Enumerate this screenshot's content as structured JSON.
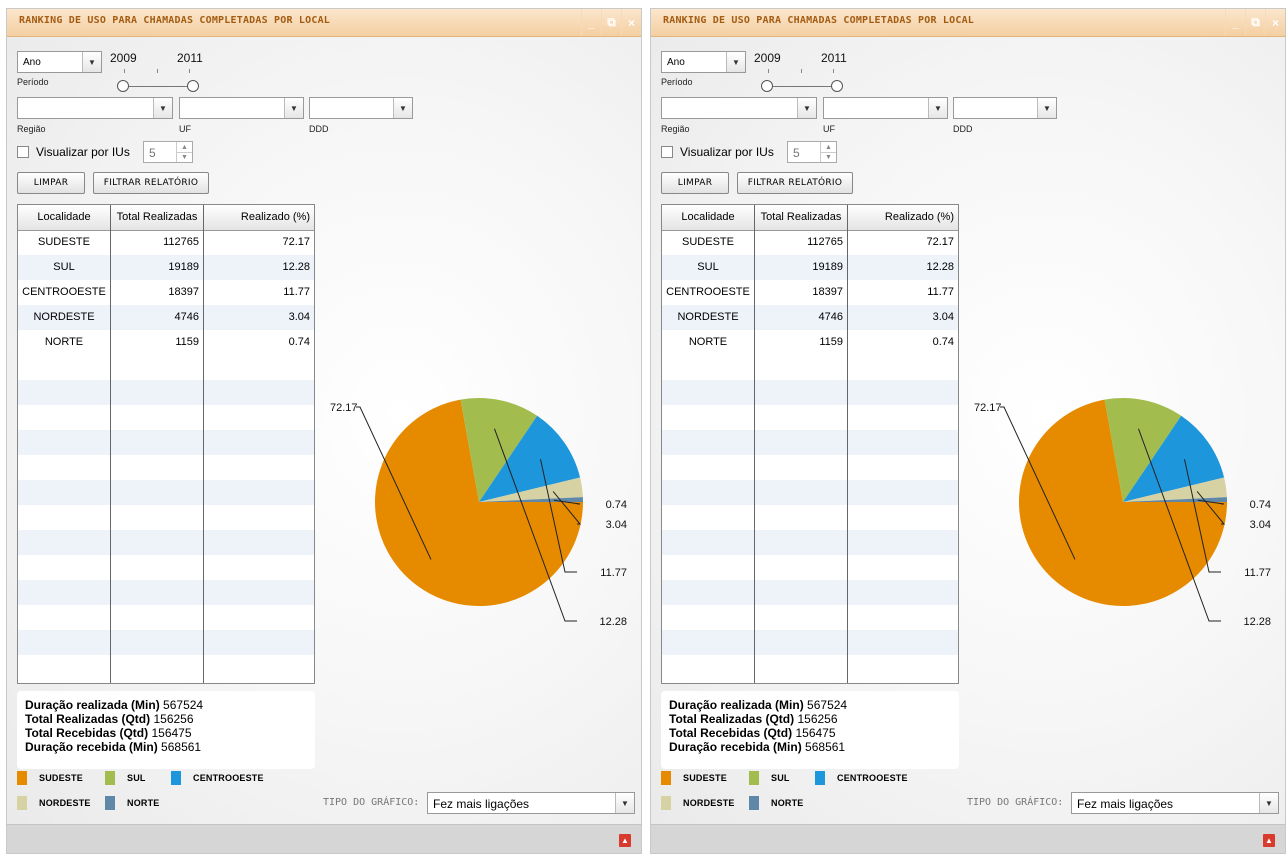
{
  "panel": {
    "title": "RANKING DE USO PARA CHAMADAS COMPLETADAS POR LOCAL",
    "window_buttons": [
      "_",
      "⧉",
      "×"
    ],
    "period": {
      "select_value": "Ano",
      "label": "Período",
      "start_year": "2009",
      "end_year": "2011"
    },
    "filters": [
      {
        "label": "Região",
        "value": ""
      },
      {
        "label": "UF",
        "value": ""
      },
      {
        "label": "DDD",
        "value": ""
      }
    ],
    "view_by_ius": {
      "label": "Visualizar por IUs",
      "checked": false,
      "value": "5"
    },
    "buttons": {
      "clear": "LIMPAR",
      "filter": "FILTRAR RELATÓRIO"
    },
    "table": {
      "headers": [
        "Localidade",
        "Total Realizadas",
        "Realizado (%)"
      ],
      "rows": [
        [
          "SUDESTE",
          "112765",
          "72.17"
        ],
        [
          "SUL",
          "19189",
          "12.28"
        ],
        [
          "CENTROOESTE",
          "18397",
          "11.77"
        ],
        [
          "NORDESTE",
          "4746",
          "3.04"
        ],
        [
          "NORTE",
          "1159",
          "0.74"
        ]
      ]
    },
    "summary": [
      {
        "label": "Duração realizada (Min)",
        "value": "567524"
      },
      {
        "label": "Total Realizadas (Qtd)",
        "value": "156256"
      },
      {
        "label": "Total Recebidas (Qtd)",
        "value": "156475"
      },
      {
        "label": "Duração recebida (Min)",
        "value": "568561"
      }
    ],
    "legend": [
      {
        "name": "SUDESTE",
        "color": "#e68a00"
      },
      {
        "name": "SUL",
        "color": "#a2bd4e"
      },
      {
        "name": "CENTROOESTE",
        "color": "#1e96dc"
      },
      {
        "name": "NORDESTE",
        "color": "#d7d2a3"
      },
      {
        "name": "NORTE",
        "color": "#5f87a8"
      }
    ],
    "chart_type": {
      "label": "TIPO DO GRÁFICO:",
      "value": "Fez mais ligações"
    },
    "icons": {
      "export": "pdf-icon"
    }
  },
  "chart_data": {
    "type": "pie",
    "categories": [
      "SUDESTE",
      "SUL",
      "CENTROOESTE",
      "NORDESTE",
      "NORTE"
    ],
    "values": [
      72.17,
      12.28,
      11.77,
      3.04,
      0.74
    ],
    "colors": [
      "#e68a00",
      "#a2bd4e",
      "#1e96dc",
      "#d7d2a3",
      "#5f87a8"
    ],
    "data_labels": [
      "72.17",
      "12.28",
      "11.77",
      "3.04",
      "0.74"
    ],
    "legend_position": "bottom-left"
  }
}
